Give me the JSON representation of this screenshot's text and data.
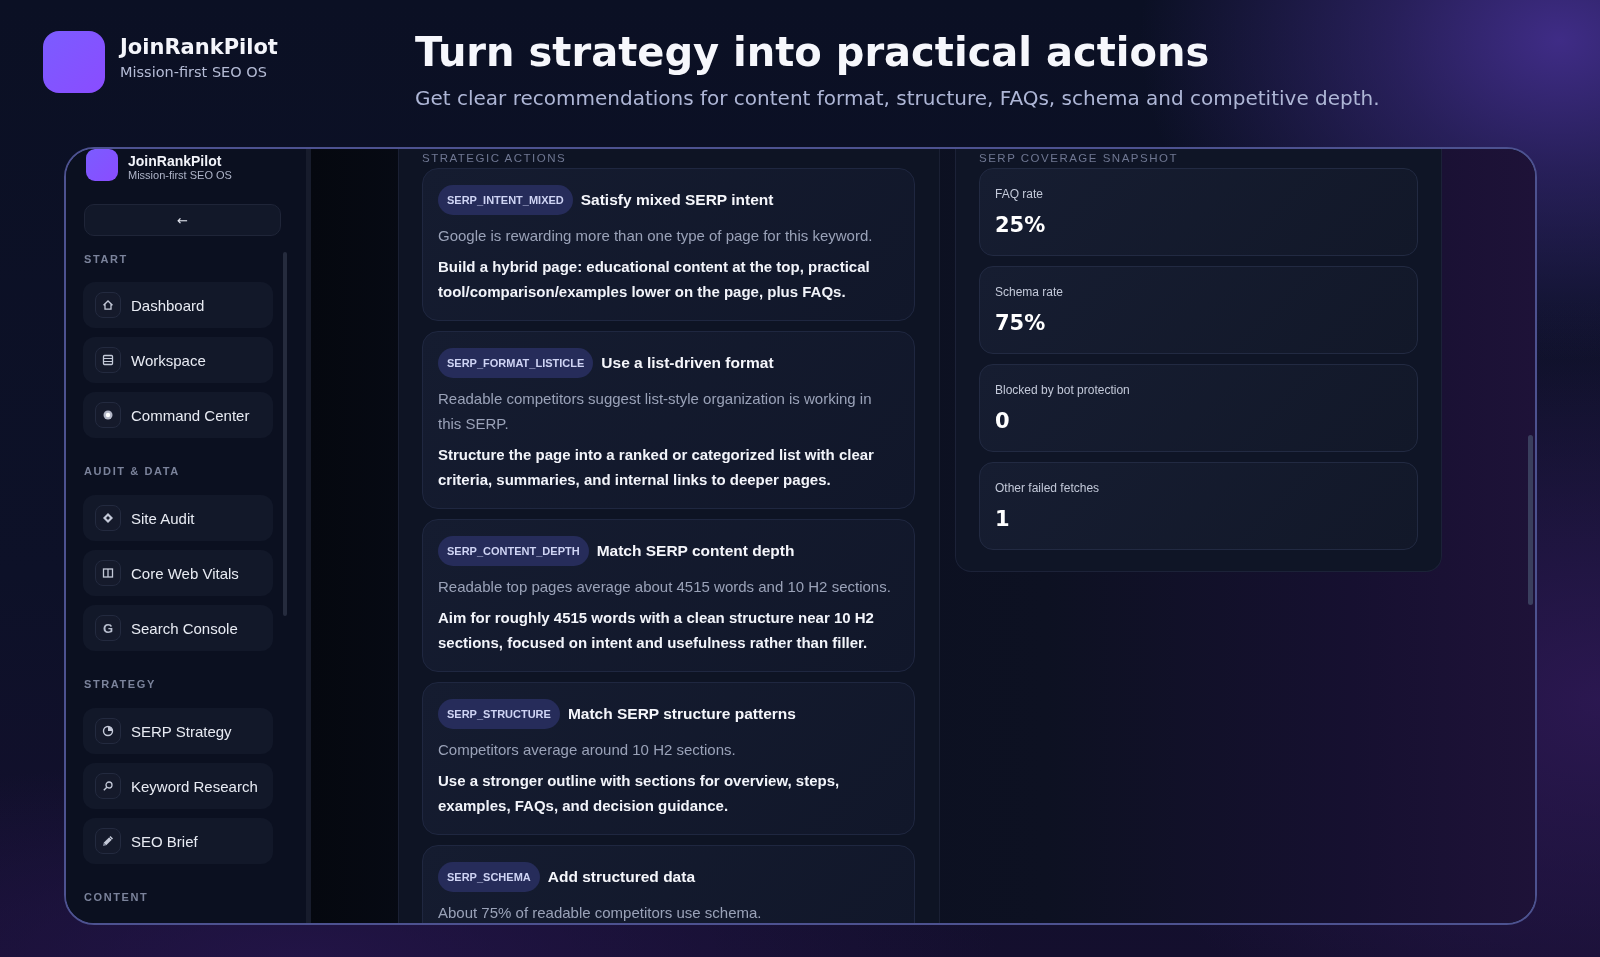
{
  "brand": {
    "name": "JoinRankPilot",
    "tagline": "Mission-first SEO OS"
  },
  "hero": {
    "title": "Turn strategy into practical actions",
    "subtitle": "Get clear recommendations for content format, structure, FAQs, schema and competitive depth."
  },
  "sidebar": {
    "brand": {
      "name": "JoinRankPilot",
      "tagline": "Mission-first SEO OS"
    },
    "back_button": "←",
    "sections": [
      {
        "title": "START",
        "items": [
          {
            "label": "Dashboard",
            "kind": "icon"
          },
          {
            "label": "Workspace",
            "kind": "icon"
          },
          {
            "label": "Command Center",
            "kind": "icon"
          }
        ]
      },
      {
        "title": "AUDIT & DATA",
        "items": [
          {
            "label": "Site Audit",
            "kind": "icon"
          },
          {
            "label": "Core Web Vitals",
            "kind": "icon"
          },
          {
            "label": "Search Console",
            "kind": "letter",
            "glyph": "G"
          }
        ]
      },
      {
        "title": "STRATEGY",
        "items": [
          {
            "label": "SERP Strategy",
            "kind": "icon"
          },
          {
            "label": "Keyword Research",
            "kind": "icon"
          },
          {
            "label": "SEO Brief",
            "kind": "icon"
          }
        ]
      },
      {
        "title": "CONTENT"
      }
    ]
  },
  "actions": {
    "title": "STRATEGIC ACTIONS",
    "items": [
      {
        "code": "SERP_INTENT_MIXED",
        "title": "Satisfy mixed SERP intent",
        "finding": "Google is rewarding more than one type of page for this keyword.",
        "recommendation": "Build a hybrid page: educational content at the top, practical tool/comparison/examples lower on the page, plus FAQs."
      },
      {
        "code": "SERP_FORMAT_LISTICLE",
        "title": "Use a list-driven format",
        "finding": "Readable competitors suggest list-style organization is working in this SERP.",
        "recommendation": "Structure the page into a ranked or categorized list with clear criteria, summaries, and internal links to deeper pages."
      },
      {
        "code": "SERP_CONTENT_DEPTH",
        "title": "Match SERP content depth",
        "finding": "Readable top pages average about 4515 words and 10 H2 sections.",
        "recommendation": "Aim for roughly 4515 words with a clean structure near 10 H2 sections, focused on intent and usefulness rather than filler."
      },
      {
        "code": "SERP_STRUCTURE",
        "title": "Match SERP structure patterns",
        "finding": "Competitors average around 10 H2 sections.",
        "recommendation": "Use a stronger outline with sections for overview, steps, examples, FAQs, and decision guidance."
      },
      {
        "code": "SERP_SCHEMA",
        "title": "Add structured data",
        "finding": "About 75% of readable competitors use schema."
      }
    ]
  },
  "snapshot": {
    "title": "SERP COVERAGE SNAPSHOT",
    "metrics": [
      {
        "label": "FAQ rate",
        "value": "25%"
      },
      {
        "label": "Schema rate",
        "value": "75%"
      },
      {
        "label": "Blocked by bot protection",
        "value": "0"
      },
      {
        "label": "Other failed fetches",
        "value": "1"
      }
    ]
  }
}
